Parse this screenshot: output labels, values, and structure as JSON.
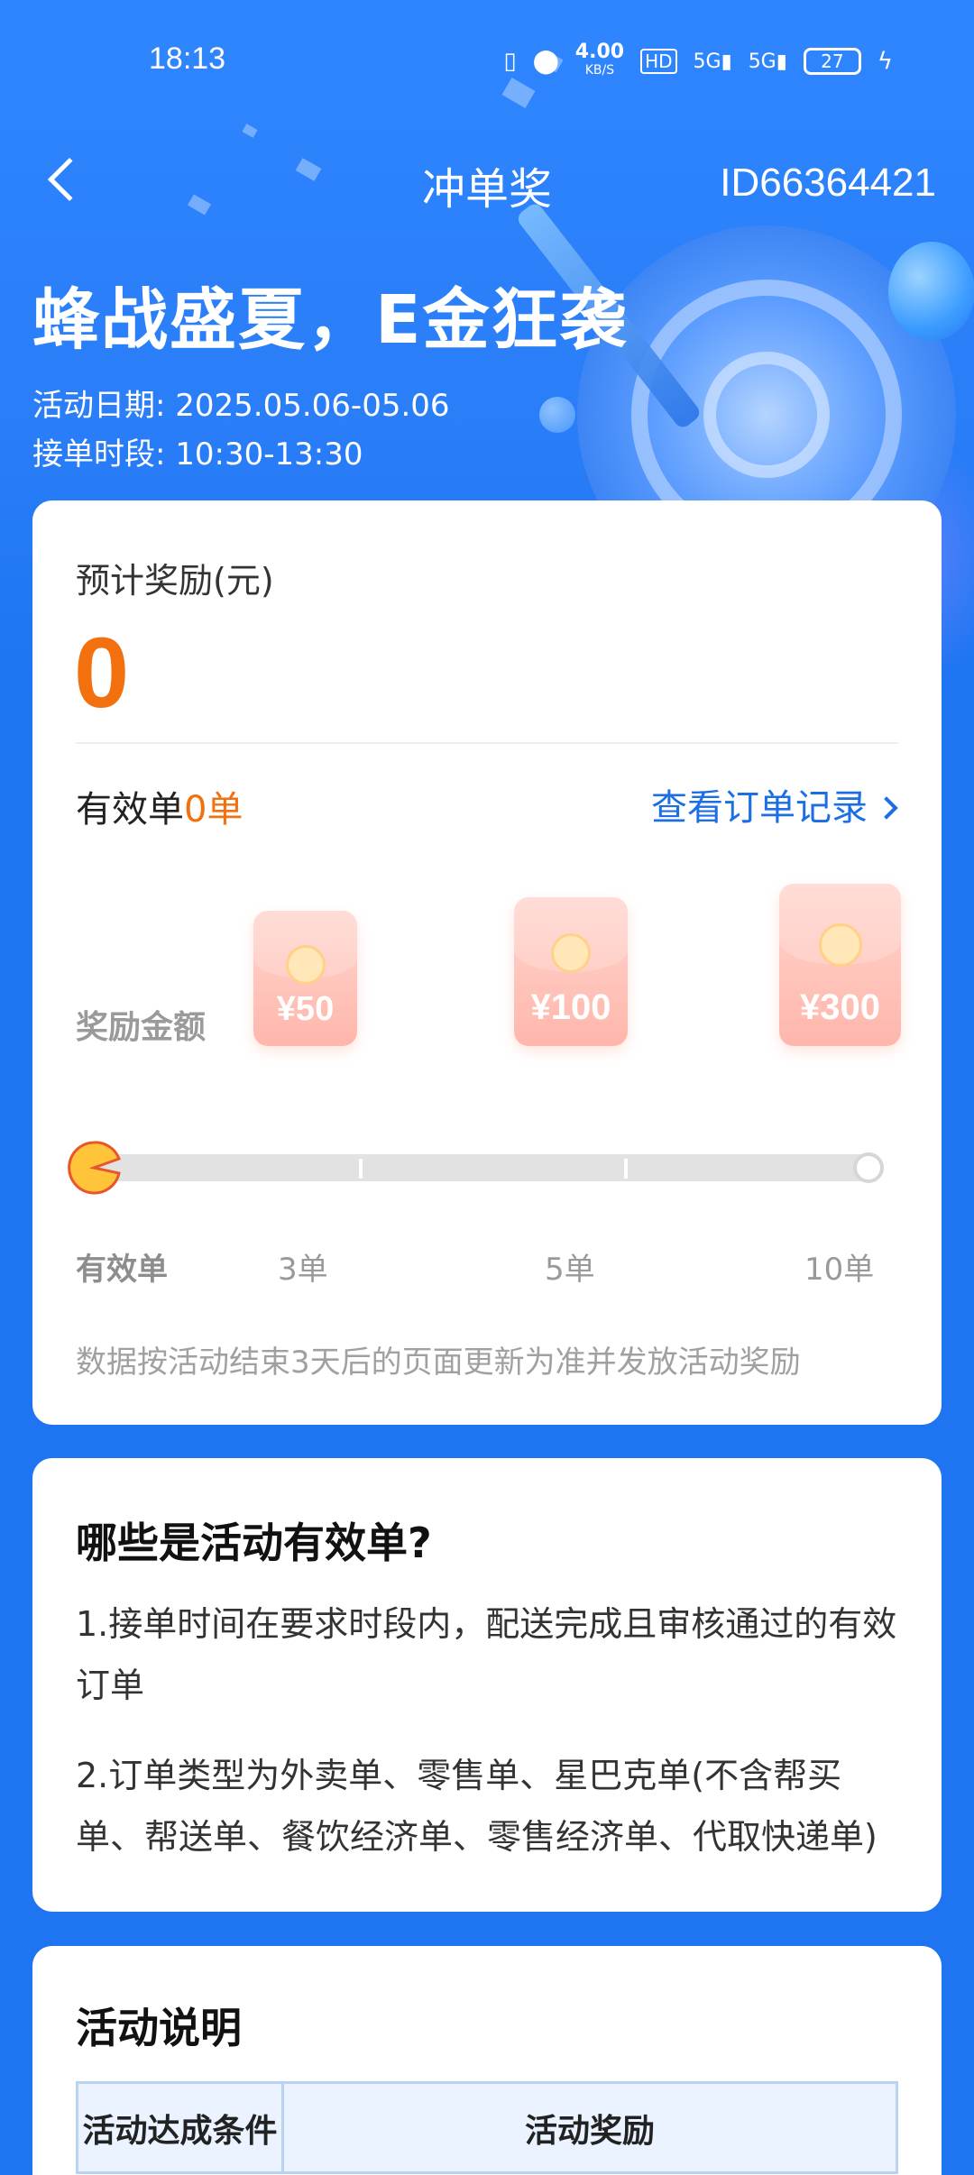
{
  "status_bar": {
    "time": "18:13",
    "net_speed": "4.00",
    "net_speed_unit": "KB/S",
    "battery": "27"
  },
  "nav": {
    "title": "冲单奖",
    "id_text": "ID66364421"
  },
  "hero": {
    "headline": "蜂战盛夏，E金狂袭",
    "date_line": "活动日期: 2025.05.06-05.06",
    "time_line": "接单时段: 10:30-13:30"
  },
  "summary": {
    "est_label": "预计奖励(元)",
    "est_amount": "0",
    "valid_prefix": "有效单",
    "valid_count": "0单",
    "view_link": "查看订单记录"
  },
  "rewards": {
    "label": "奖励金额",
    "tiers": [
      {
        "amount": "¥50",
        "orders": "3单"
      },
      {
        "amount": "¥100",
        "orders": "5单"
      },
      {
        "amount": "¥300",
        "orders": "10单"
      }
    ],
    "axis_label": "有效单",
    "progress": 0,
    "note": "数据按活动结束3天后的页面更新为准并发放活动奖励"
  },
  "valid_orders": {
    "title": "哪些是活动有效单?",
    "items": [
      "1.接单时间在要求时段内，配送完成且审核通过的有效订单",
      "2.订单类型为外卖单、零售单、星巴克单(不含帮买单、帮送单、餐饮经济单、零售经济单、代取快递单)"
    ]
  },
  "description": {
    "title": "活动说明",
    "col_condition": "活动达成条件",
    "col_reward": "活动奖励"
  },
  "colors": {
    "primary_blue": "#1f74f1",
    "accent_orange": "#f2700d",
    "link_blue": "#1b6ee3"
  }
}
